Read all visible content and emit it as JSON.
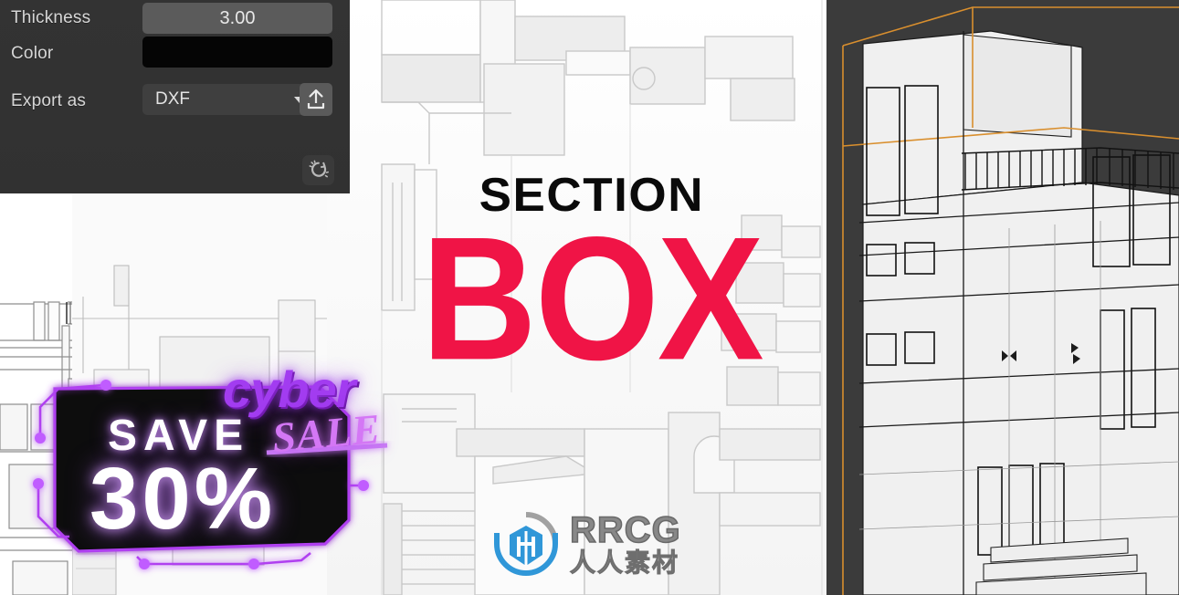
{
  "app": {
    "product_title_line1": "SECTION",
    "product_title_line2": "BOX",
    "title_color": "#f01446"
  },
  "properties_panel": {
    "rows": [
      {
        "label": "Thickness",
        "value": "3.00",
        "type": "number"
      },
      {
        "label": "Color",
        "value": "",
        "type": "color",
        "swatch_hex": "#050505"
      },
      {
        "label": "Export as",
        "value": "DXF",
        "type": "select"
      }
    ],
    "thickness_label": "Thickness",
    "thickness_value": "3.00",
    "color_label": "Color",
    "color_value_hex": "#050505",
    "export_label": "Export as",
    "export_format": "DXF",
    "export_format_options": [
      "DXF"
    ],
    "export_button_icon": "upload-icon",
    "dropdown_icon": "chevron-down-icon",
    "refresh_icon": "refresh-spinner-icon"
  },
  "viewport": {
    "background_hex": "#3b3b3b",
    "section_box_outline_hex": "#d98f2e",
    "content": "3d-building-wireframe"
  },
  "drawings": {
    "plan_label": "architectural-plan",
    "elevation_label": "building-elevation"
  },
  "promo": {
    "cyber": "cyber",
    "sale": "SALE",
    "save": "SAVE",
    "percent": "30%",
    "accent_hex": "#a23cf0",
    "glow_hex": "#d477f5"
  },
  "watermark": {
    "brand_en": "RRCG",
    "brand_cn": "人人素材",
    "mark_icon": "rrcg-shield-icon"
  }
}
